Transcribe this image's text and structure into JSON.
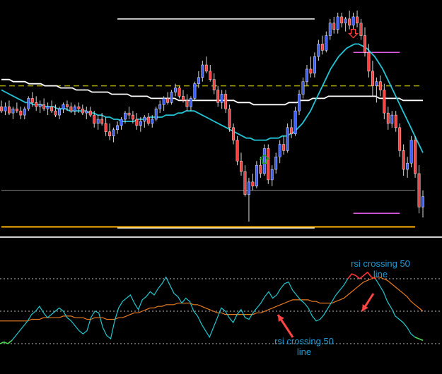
{
  "chart_data": [
    {
      "type": "candlestick",
      "title": "",
      "xlabel": "",
      "ylabel": "",
      "ylim": [
        0,
        100
      ],
      "grid": false,
      "colors": {
        "up": "#3a5cff",
        "down": "#ff3b3b",
        "wick": "#ffffff",
        "ma_fast": "#21c5d6",
        "ma_slow": "#ffffff",
        "dashed_level": "#a9a200",
        "support_line": "#ffb000",
        "horizontal_markers": "#e058e0",
        "reference_line": "#9a9a9a"
      },
      "candles": [
        {
          "o": 58,
          "h": 61,
          "l": 55,
          "c": 56
        },
        {
          "o": 56,
          "h": 60,
          "l": 54,
          "c": 58
        },
        {
          "o": 58,
          "h": 61,
          "l": 54,
          "c": 55
        },
        {
          "o": 55,
          "h": 58,
          "l": 52,
          "c": 57
        },
        {
          "o": 57,
          "h": 60,
          "l": 55,
          "c": 56
        },
        {
          "o": 56,
          "h": 58,
          "l": 52,
          "c": 54
        },
        {
          "o": 54,
          "h": 58,
          "l": 52,
          "c": 57
        },
        {
          "o": 57,
          "h": 63,
          "l": 56,
          "c": 62
        },
        {
          "o": 62,
          "h": 65,
          "l": 58,
          "c": 60
        },
        {
          "o": 60,
          "h": 63,
          "l": 56,
          "c": 58
        },
        {
          "o": 58,
          "h": 61,
          "l": 55,
          "c": 59
        },
        {
          "o": 59,
          "h": 62,
          "l": 56,
          "c": 57
        },
        {
          "o": 57,
          "h": 60,
          "l": 54,
          "c": 58
        },
        {
          "o": 58,
          "h": 61,
          "l": 55,
          "c": 56
        },
        {
          "o": 56,
          "h": 59,
          "l": 53,
          "c": 54
        },
        {
          "o": 54,
          "h": 58,
          "l": 52,
          "c": 57
        },
        {
          "o": 57,
          "h": 60,
          "l": 55,
          "c": 59
        },
        {
          "o": 59,
          "h": 61,
          "l": 56,
          "c": 58
        },
        {
          "o": 58,
          "h": 60,
          "l": 55,
          "c": 56
        },
        {
          "o": 56,
          "h": 59,
          "l": 54,
          "c": 58
        },
        {
          "o": 58,
          "h": 60,
          "l": 55,
          "c": 57
        },
        {
          "o": 57,
          "h": 59,
          "l": 54,
          "c": 55
        },
        {
          "o": 55,
          "h": 58,
          "l": 52,
          "c": 56
        },
        {
          "o": 56,
          "h": 58,
          "l": 53,
          "c": 54
        },
        {
          "o": 54,
          "h": 56,
          "l": 48,
          "c": 50
        },
        {
          "o": 50,
          "h": 54,
          "l": 47,
          "c": 52
        },
        {
          "o": 52,
          "h": 55,
          "l": 49,
          "c": 50
        },
        {
          "o": 50,
          "h": 53,
          "l": 44,
          "c": 46
        },
        {
          "o": 46,
          "h": 50,
          "l": 42,
          "c": 44
        },
        {
          "o": 44,
          "h": 48,
          "l": 41,
          "c": 47
        },
        {
          "o": 47,
          "h": 51,
          "l": 45,
          "c": 49
        },
        {
          "o": 49,
          "h": 53,
          "l": 47,
          "c": 52
        },
        {
          "o": 52,
          "h": 56,
          "l": 50,
          "c": 55
        },
        {
          "o": 55,
          "h": 58,
          "l": 52,
          "c": 54
        },
        {
          "o": 54,
          "h": 56,
          "l": 50,
          "c": 52
        },
        {
          "o": 52,
          "h": 55,
          "l": 47,
          "c": 49
        },
        {
          "o": 49,
          "h": 53,
          "l": 46,
          "c": 51
        },
        {
          "o": 51,
          "h": 54,
          "l": 48,
          "c": 53
        },
        {
          "o": 53,
          "h": 55,
          "l": 49,
          "c": 50
        },
        {
          "o": 50,
          "h": 54,
          "l": 48,
          "c": 52
        },
        {
          "o": 52,
          "h": 58,
          "l": 51,
          "c": 57
        },
        {
          "o": 57,
          "h": 61,
          "l": 55,
          "c": 59
        },
        {
          "o": 59,
          "h": 63,
          "l": 56,
          "c": 62
        },
        {
          "o": 62,
          "h": 65,
          "l": 59,
          "c": 60
        },
        {
          "o": 60,
          "h": 66,
          "l": 59,
          "c": 65
        },
        {
          "o": 65,
          "h": 69,
          "l": 63,
          "c": 67
        },
        {
          "o": 67,
          "h": 68,
          "l": 62,
          "c": 63
        },
        {
          "o": 63,
          "h": 66,
          "l": 60,
          "c": 61
        },
        {
          "o": 61,
          "h": 64,
          "l": 56,
          "c": 58
        },
        {
          "o": 58,
          "h": 63,
          "l": 56,
          "c": 62
        },
        {
          "o": 62,
          "h": 70,
          "l": 61,
          "c": 69
        },
        {
          "o": 69,
          "h": 75,
          "l": 67,
          "c": 72
        },
        {
          "o": 72,
          "h": 80,
          "l": 70,
          "c": 78
        },
        {
          "o": 78,
          "h": 82,
          "l": 74,
          "c": 75
        },
        {
          "o": 75,
          "h": 78,
          "l": 70,
          "c": 71
        },
        {
          "o": 71,
          "h": 74,
          "l": 64,
          "c": 66
        },
        {
          "o": 66,
          "h": 68,
          "l": 58,
          "c": 60
        },
        {
          "o": 60,
          "h": 66,
          "l": 57,
          "c": 64
        },
        {
          "o": 64,
          "h": 66,
          "l": 55,
          "c": 57
        },
        {
          "o": 57,
          "h": 59,
          "l": 46,
          "c": 48
        },
        {
          "o": 48,
          "h": 50,
          "l": 40,
          "c": 42
        },
        {
          "o": 42,
          "h": 44,
          "l": 30,
          "c": 32
        },
        {
          "o": 32,
          "h": 36,
          "l": 25,
          "c": 27
        },
        {
          "o": 27,
          "h": 30,
          "l": 15,
          "c": 16
        },
        {
          "o": 16,
          "h": 24,
          "l": 3,
          "c": 22
        },
        {
          "o": 22,
          "h": 26,
          "l": 18,
          "c": 20
        },
        {
          "o": 20,
          "h": 32,
          "l": 19,
          "c": 30
        },
        {
          "o": 30,
          "h": 34,
          "l": 24,
          "c": 26
        },
        {
          "o": 26,
          "h": 40,
          "l": 25,
          "c": 38
        },
        {
          "o": 38,
          "h": 40,
          "l": 21,
          "c": 23
        },
        {
          "o": 23,
          "h": 30,
          "l": 20,
          "c": 28
        },
        {
          "o": 28,
          "h": 36,
          "l": 26,
          "c": 34
        },
        {
          "o": 34,
          "h": 42,
          "l": 31,
          "c": 40
        },
        {
          "o": 40,
          "h": 44,
          "l": 35,
          "c": 37
        },
        {
          "o": 37,
          "h": 50,
          "l": 36,
          "c": 48
        },
        {
          "o": 48,
          "h": 52,
          "l": 43,
          "c": 45
        },
        {
          "o": 45,
          "h": 58,
          "l": 44,
          "c": 56
        },
        {
          "o": 56,
          "h": 66,
          "l": 54,
          "c": 64
        },
        {
          "o": 64,
          "h": 72,
          "l": 62,
          "c": 70
        },
        {
          "o": 70,
          "h": 78,
          "l": 68,
          "c": 76
        },
        {
          "o": 76,
          "h": 82,
          "l": 72,
          "c": 74
        },
        {
          "o": 74,
          "h": 84,
          "l": 72,
          "c": 82
        },
        {
          "o": 82,
          "h": 90,
          "l": 80,
          "c": 88
        },
        {
          "o": 88,
          "h": 92,
          "l": 83,
          "c": 85
        },
        {
          "o": 85,
          "h": 94,
          "l": 84,
          "c": 92
        },
        {
          "o": 92,
          "h": 100,
          "l": 90,
          "c": 98
        },
        {
          "o": 98,
          "h": 101,
          "l": 93,
          "c": 95
        },
        {
          "o": 95,
          "h": 103,
          "l": 93,
          "c": 101
        },
        {
          "o": 101,
          "h": 103,
          "l": 96,
          "c": 98
        },
        {
          "o": 98,
          "h": 101,
          "l": 94,
          "c": 100
        },
        {
          "o": 100,
          "h": 104,
          "l": 95,
          "c": 97
        },
        {
          "o": 97,
          "h": 103,
          "l": 95,
          "c": 101
        },
        {
          "o": 101,
          "h": 104,
          "l": 96,
          "c": 98
        },
        {
          "o": 98,
          "h": 100,
          "l": 90,
          "c": 92
        },
        {
          "o": 92,
          "h": 96,
          "l": 82,
          "c": 84
        },
        {
          "o": 84,
          "h": 88,
          "l": 72,
          "c": 75
        },
        {
          "o": 75,
          "h": 80,
          "l": 63,
          "c": 68
        },
        {
          "o": 68,
          "h": 72,
          "l": 60,
          "c": 70
        },
        {
          "o": 70,
          "h": 73,
          "l": 63,
          "c": 66
        },
        {
          "o": 66,
          "h": 69,
          "l": 52,
          "c": 55
        },
        {
          "o": 55,
          "h": 58,
          "l": 47,
          "c": 50
        },
        {
          "o": 50,
          "h": 56,
          "l": 48,
          "c": 54
        },
        {
          "o": 54,
          "h": 56,
          "l": 46,
          "c": 48
        },
        {
          "o": 48,
          "h": 50,
          "l": 34,
          "c": 37
        },
        {
          "o": 37,
          "h": 40,
          "l": 25,
          "c": 28
        },
        {
          "o": 28,
          "h": 34,
          "l": 24,
          "c": 31
        },
        {
          "o": 31,
          "h": 44,
          "l": 29,
          "c": 42
        },
        {
          "o": 42,
          "h": 44,
          "l": 24,
          "c": 26
        },
        {
          "o": 26,
          "h": 30,
          "l": 7,
          "c": 10
        },
        {
          "o": 10,
          "h": 18,
          "l": 5,
          "c": 15
        }
      ],
      "ma_fast": [
        66,
        65,
        64,
        63,
        62,
        61,
        60,
        60,
        59,
        59,
        59,
        58,
        58,
        58,
        57,
        57,
        57,
        56,
        56,
        56,
        56,
        56,
        55,
        55,
        54,
        54,
        53,
        53,
        52,
        52,
        51,
        51,
        51,
        51,
        52,
        52,
        52,
        53,
        53,
        53,
        53,
        54,
        54,
        54,
        55,
        55,
        56,
        56,
        56,
        55,
        54,
        53,
        52,
        51,
        50,
        49,
        48,
        47,
        46,
        45,
        44,
        43,
        43,
        42,
        42,
        42,
        42,
        43,
        43,
        43,
        44,
        44,
        45,
        46,
        48,
        50,
        53,
        56,
        60,
        64,
        68,
        72,
        76,
        79,
        82,
        84,
        86,
        87,
        88,
        88,
        87,
        86,
        84,
        82,
        79,
        76,
        72,
        68,
        64,
        60,
        56,
        52,
        48,
        44,
        40,
        36
      ],
      "ma_slow": [
        71,
        71,
        71,
        70,
        70,
        70,
        70,
        69,
        69,
        69,
        69,
        68,
        68,
        68,
        68,
        67,
        67,
        67,
        67,
        66,
        66,
        66,
        66,
        65,
        65,
        65,
        65,
        65,
        64,
        64,
        64,
        64,
        64,
        63,
        63,
        63,
        63,
        63,
        62,
        62,
        62,
        62,
        62,
        62,
        62,
        61,
        61,
        61,
        61,
        61,
        61,
        61,
        61,
        61,
        61,
        61,
        61,
        61,
        61,
        61,
        60,
        60,
        60,
        60,
        59,
        59,
        59,
        59,
        59,
        59,
        59,
        59,
        59,
        60,
        60,
        60,
        61,
        61,
        61,
        62,
        62,
        62,
        62,
        63,
        63,
        63,
        63,
        63,
        63,
        63,
        63,
        63,
        63,
        63,
        63,
        63,
        62,
        62,
        62,
        62,
        62,
        62,
        61,
        61,
        61,
        61,
        61,
        61
      ],
      "dashed_level": 68,
      "horizontal_lines": [
        {
          "value": 100,
          "from_bar": 30,
          "to_bar": 81,
          "color": "white"
        },
        {
          "value": 84,
          "from_bar": 91,
          "to_bar": 103,
          "color": "magenta"
        },
        {
          "value": 7,
          "from_bar": 91,
          "to_bar": 103,
          "color": "magenta"
        },
        {
          "value": 0,
          "from_bar": 30,
          "to_bar": 81,
          "color": "white"
        },
        {
          "value": 0.5,
          "from_bar": 0,
          "to_bar": 107,
          "color": "orange"
        },
        {
          "value": 18,
          "from_bar": 0,
          "to_bar": 107,
          "color": "gray"
        }
      ],
      "signals": [
        {
          "type": "down-arrow",
          "bar": 91,
          "value": 92,
          "color": "#ff3b3b"
        },
        {
          "type": "up-arrow",
          "bar": 68,
          "value": 34,
          "color": "#17a817"
        }
      ]
    },
    {
      "type": "line",
      "title": "",
      "xlabel": "",
      "ylabel": "",
      "ylim": [
        20,
        80
      ],
      "grid": false,
      "levels": [
        70,
        50,
        30
      ],
      "colors": {
        "rsi": "#1fc8cf",
        "signal": "#e87a1e",
        "ob": "#ff3030",
        "os": "#4cd64c"
      },
      "series": [
        {
          "values": [
            30,
            31,
            30,
            32,
            35,
            38,
            41,
            44,
            48,
            50,
            53,
            49,
            46,
            48,
            50,
            52,
            50,
            46,
            44,
            41,
            38,
            36,
            38,
            46,
            50,
            49,
            40,
            35,
            33,
            44,
            52,
            56,
            58,
            60,
            55,
            51,
            57,
            59,
            62,
            60,
            64,
            67,
            71,
            66,
            61,
            59,
            55,
            58,
            56,
            50,
            47,
            42,
            38,
            34,
            40,
            46,
            52,
            50,
            46,
            43,
            48,
            51,
            46,
            45,
            49,
            52,
            55,
            59,
            62,
            58,
            60,
            64,
            67,
            68,
            63,
            60,
            57,
            55,
            52,
            47,
            44,
            45,
            48,
            52,
            56,
            60,
            63,
            66,
            70,
            73,
            72,
            70,
            72,
            74,
            71,
            70,
            66,
            62,
            56,
            52,
            47,
            45,
            43,
            40,
            36,
            34,
            33,
            32
          ]
        },
        {
          "values": [
            44,
            44,
            44,
            44,
            44,
            44,
            44,
            44,
            45,
            45,
            45,
            46,
            46,
            46,
            46,
            46,
            47,
            47,
            47,
            46,
            46,
            46,
            45,
            45,
            46,
            46,
            46,
            45,
            45,
            45,
            46,
            46,
            47,
            48,
            49,
            49,
            50,
            51,
            52,
            52,
            53,
            53,
            54,
            54,
            54,
            55,
            55,
            55,
            55,
            54,
            54,
            53,
            52,
            51,
            50,
            49,
            49,
            48,
            48,
            48,
            48,
            48,
            48,
            48,
            48,
            49,
            49,
            50,
            51,
            52,
            53,
            54,
            55,
            56,
            57,
            57,
            57,
            57,
            57,
            56,
            56,
            55,
            55,
            55,
            55,
            56,
            57,
            58,
            60,
            62,
            64,
            66,
            68,
            69,
            70,
            71,
            71,
            70,
            69,
            67,
            65,
            63,
            61,
            59,
            56,
            54,
            52,
            50
          ]
        }
      ],
      "annotations": [
        {
          "text_lines": [
            "rsi crossing 50",
            "line"
          ],
          "color": "#1e9bd7"
        },
        {
          "text_lines": [
            "rsi crossing 50",
            "line"
          ],
          "color": "#1e9bd7"
        }
      ]
    }
  ]
}
